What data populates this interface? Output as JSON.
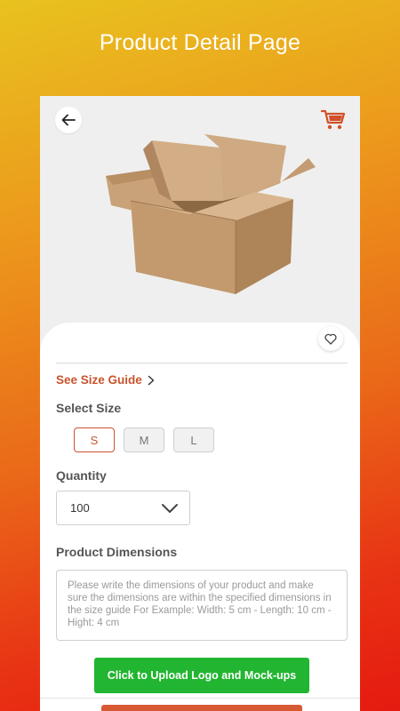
{
  "banner": {
    "title": "Product Detail Page"
  },
  "colors": {
    "accent": "#c8542d",
    "upload": "#22b531",
    "gradient_top": "#e8c21f",
    "gradient_bottom": "#e51a10"
  },
  "header": {
    "back_icon": "arrow-left-icon",
    "cart_icon": "cart-icon"
  },
  "product": {
    "image": "cardboard-box",
    "favorite_icon": "heart-icon"
  },
  "size_guide": {
    "label": "See Size Guide",
    "icon": "chevron-right-icon"
  },
  "select_size": {
    "label": "Select Size",
    "options": [
      "S",
      "M",
      "L"
    ],
    "selected": "S"
  },
  "quantity": {
    "label": "Quantity",
    "value": "100",
    "icon": "chevron-down-icon"
  },
  "dimensions": {
    "label": "Product Dimensions",
    "placeholder": "Please write the dimensions of your product and make sure the dimensions are within the specified dimensions in the size guide For Example:  Width: 5 cm - Length: 10 cm - Hight: 4 cm"
  },
  "upload_button": {
    "label": "Click to Upload Logo and Mock-ups"
  }
}
